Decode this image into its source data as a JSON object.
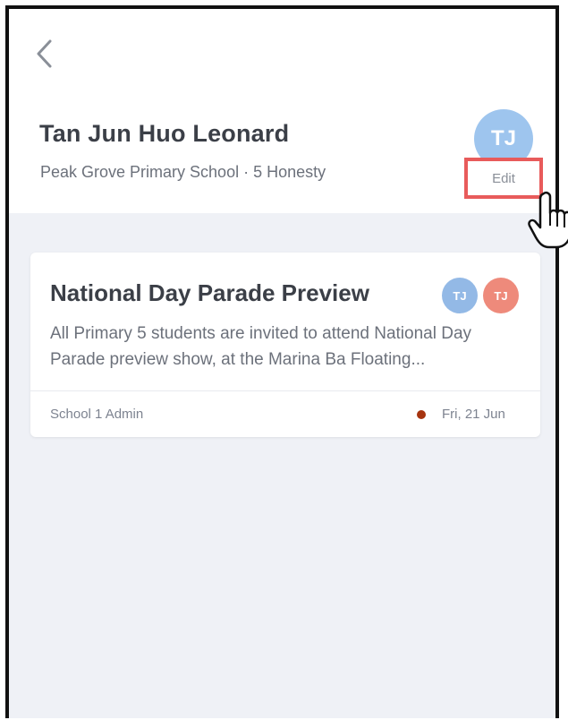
{
  "profile": {
    "name": "Tan Jun Huo Leonard",
    "school_line": "Peak Grove Primary School · 5 Honesty",
    "avatar_initials": "TJ",
    "edit_label": "Edit"
  },
  "announcement": {
    "title": "National Day Parade Preview",
    "body": "All Primary 5 students are invited to attend National Day Parade preview show, at the Marina Ba Floating...",
    "chips": [
      {
        "initials": "TJ",
        "color": "#93b9e6"
      },
      {
        "initials": "TJ",
        "color": "#ee8a7b"
      }
    ],
    "author": "School 1 Admin",
    "date": "Fri, 21 Jun",
    "status_color": "#a6340f"
  },
  "icons": {
    "back": "chevron-left-icon",
    "cursor": "hand-pointer-icon"
  }
}
